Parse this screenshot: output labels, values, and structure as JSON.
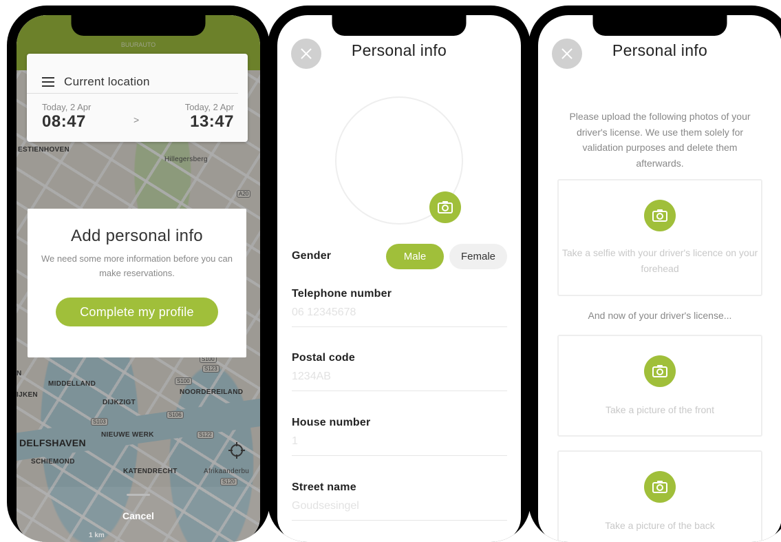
{
  "screen1": {
    "brand": "BUURAUTO",
    "location_card": {
      "title": "Current location",
      "start_date": "Today, 2 Apr",
      "start_time": "08:47",
      "end_date": "Today, 2 Apr",
      "end_time": "13:47",
      "arrow": ">"
    },
    "map_labels": [
      "ESTIENHOVEN",
      "Hillegersberg",
      "MIDDELLAND",
      "NOORDEREILAND",
      "DIJKZIGT",
      "NIEUWE WERK",
      "DELFSHAVEN",
      "SCHIEMOND",
      "KATENDRECHT",
      "Afrikaanderbu",
      "IJKEN",
      "N"
    ],
    "road_badges": [
      "A20",
      "S100",
      "S123",
      "S100",
      "S106",
      "S103",
      "S122",
      "S120"
    ],
    "dialog": {
      "title": "Add personal info",
      "message": "We need some more information before you can make reservations.",
      "button": "Complete my profile"
    },
    "cancel": "Cancel",
    "scale": "1 km"
  },
  "screen2": {
    "title": "Personal info",
    "gender_label": "Gender",
    "gender_options": [
      "Male",
      "Female"
    ],
    "gender_selected": "Male",
    "fields": [
      {
        "label": "Telephone number",
        "placeholder": "06 12345678"
      },
      {
        "label": "Postal code",
        "placeholder": "1234AB"
      },
      {
        "label": "House number",
        "placeholder": "1"
      },
      {
        "label": "Street name",
        "placeholder": "Goudsesingel"
      }
    ]
  },
  "screen3": {
    "title": "Personal info",
    "intro": "Please upload the following photos of your driver's license. We use them solely for validation purposes and delete them afterwards.",
    "selfie_caption": "Take a selfie with your driver's licence on your forehead",
    "sub_intro": "And now of your driver's license...",
    "front_caption": "Take a picture of the front",
    "back_caption": "Take a picture of the back"
  },
  "colors": {
    "accent": "#a0bf3a",
    "close_button": "#d0d0d0",
    "placeholder_text": "#e2e2e2"
  },
  "icons": [
    "hamburger-icon",
    "close-icon",
    "camera-icon",
    "locate-icon"
  ]
}
